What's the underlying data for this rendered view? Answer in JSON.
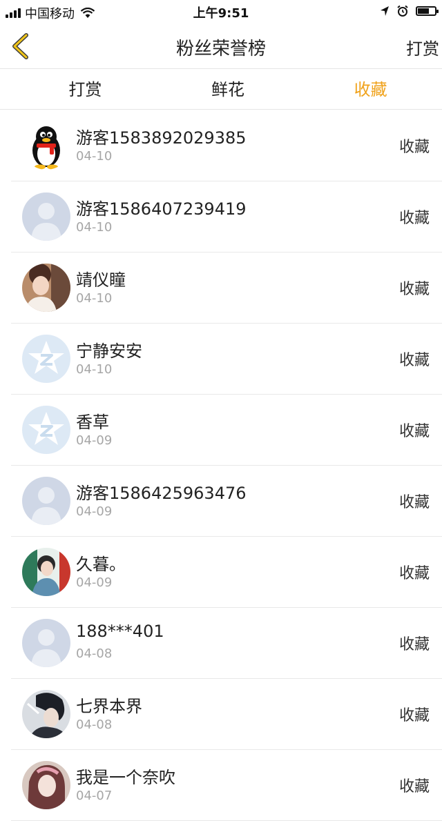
{
  "status_bar": {
    "carrier": "中国移动",
    "time": "上午9:51"
  },
  "navbar": {
    "title": "粉丝荣誉榜",
    "action_label": "打赏"
  },
  "tabs": [
    {
      "label": "打赏",
      "active": false
    },
    {
      "label": "鲜花",
      "active": false
    },
    {
      "label": "收藏",
      "active": true
    }
  ],
  "accent_color": "#f0a21b",
  "fans": [
    {
      "name": "游客1583892029385",
      "date": "04-10",
      "action": "收藏",
      "avatar": "qq-penguin-avatar"
    },
    {
      "name": "游客1586407239419",
      "date": "04-10",
      "action": "收藏",
      "avatar": "default-person-avatar"
    },
    {
      "name": "靖仪瞳",
      "date": "04-10",
      "action": "收藏",
      "avatar": "photo-avatar"
    },
    {
      "name": "宁静安安",
      "date": "04-10",
      "action": "收藏",
      "avatar": "qzone-star-avatar"
    },
    {
      "name": "香草",
      "date": "04-09",
      "action": "收藏",
      "avatar": "qzone-star-avatar"
    },
    {
      "name": "游客1586425963476",
      "date": "04-09",
      "action": "收藏",
      "avatar": "default-person-avatar"
    },
    {
      "name": "久暮。",
      "date": "04-09",
      "action": "收藏",
      "avatar": "photo-avatar"
    },
    {
      "name": "188***401",
      "date": "04-08",
      "action": "收藏",
      "avatar": "default-person-avatar"
    },
    {
      "name": "七界本界",
      "date": "04-08",
      "action": "收藏",
      "avatar": "photo-avatar"
    },
    {
      "name": "我是一个奈吹",
      "date": "04-07",
      "action": "收藏",
      "avatar": "photo-avatar"
    }
  ]
}
